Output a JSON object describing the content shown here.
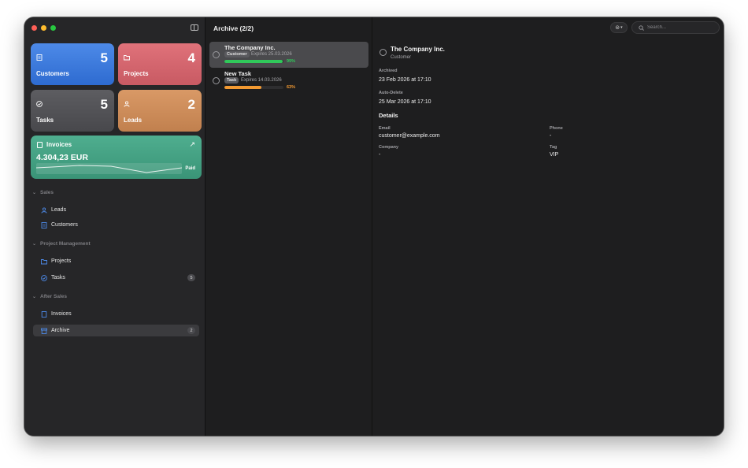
{
  "window": {
    "colors": {
      "accent_blue": "#2e6bd0",
      "green": "#30c85a",
      "orange": "#f39a32"
    }
  },
  "summary": {
    "customers": {
      "count": "5",
      "label": "Customers",
      "icon": "customers-doc-icon"
    },
    "projects": {
      "count": "4",
      "label": "Projects",
      "icon": "folder-icon"
    },
    "tasks": {
      "count": "5",
      "label": "Tasks",
      "icon": "check-circle-icon"
    },
    "leads": {
      "count": "2",
      "label": "Leads",
      "icon": "person-icon"
    },
    "invoices": {
      "label": "Invoices",
      "amount": "4.304,23 EUR",
      "status": "Paid",
      "icon": "invoice-icon"
    }
  },
  "sidebar": {
    "sections": [
      {
        "title": "Sales",
        "items": [
          {
            "label": "Leads"
          },
          {
            "label": "Customers"
          }
        ]
      },
      {
        "title": "Project Management",
        "items": [
          {
            "label": "Projects"
          },
          {
            "label": "Tasks",
            "badge": "5"
          }
        ]
      },
      {
        "title": "After Sales",
        "items": [
          {
            "label": "Invoices"
          },
          {
            "label": "Archive",
            "badge": "2"
          }
        ]
      }
    ]
  },
  "list": {
    "title": "Archive (2/2)",
    "rows": [
      {
        "title": "The Company Inc.",
        "tag": "Customer",
        "expires": "Expires 25.03.2026",
        "progress": 99,
        "pct_label": "99%"
      },
      {
        "title": "New Task",
        "tag": "Task",
        "expires": "Expires 14.03.2026",
        "progress": 63,
        "pct_label": "63%"
      }
    ]
  },
  "search": {
    "placeholder": "Search..."
  },
  "detail": {
    "name": "The Company Inc.",
    "type": "Customer",
    "archived_label": "Archived",
    "archived_value": "23 Feb 2026 at 17:10",
    "autodelete_label": "Auto-Delete",
    "autodelete_value": "25 Mar 2026 at 17:10",
    "details_heading": "Details",
    "email_label": "Email",
    "email_value": "customer@example.com",
    "phone_label": "Phone",
    "phone_value": "-",
    "company_label": "Company",
    "company_value": "-",
    "tag_label": "Tag",
    "tag_value": "VIP"
  }
}
